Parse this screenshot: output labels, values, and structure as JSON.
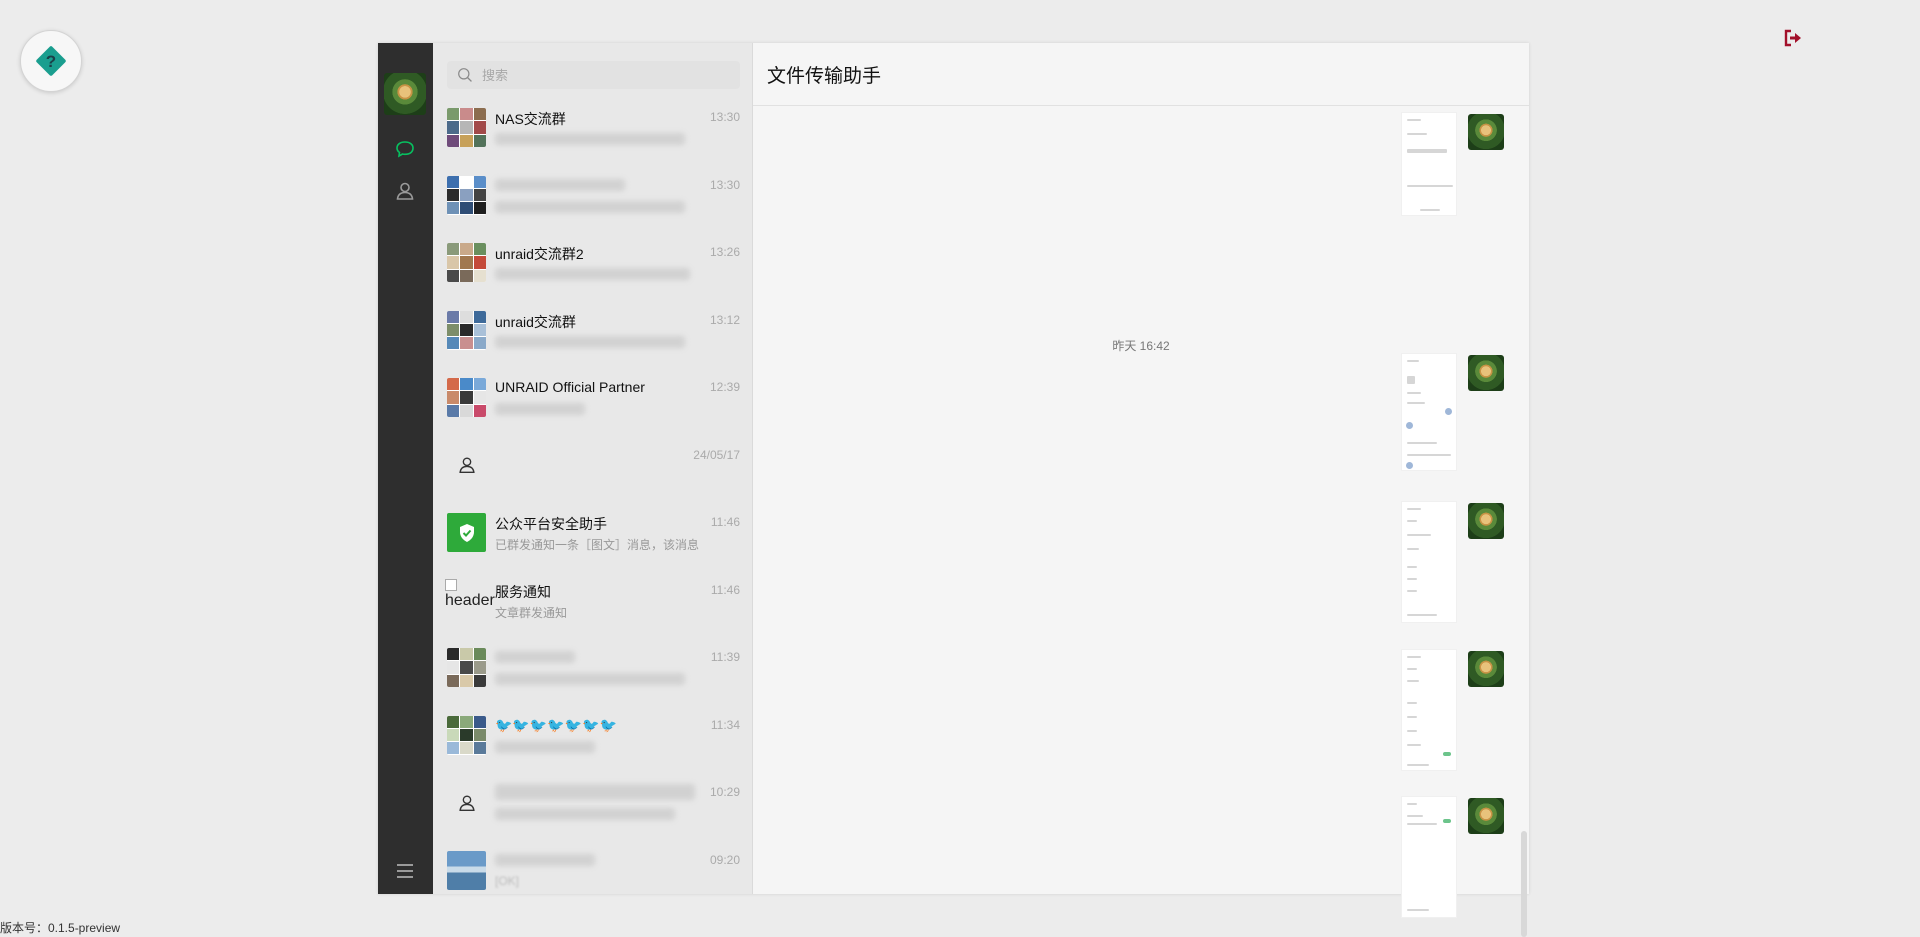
{
  "version_text": "版本号：0.1.5-preview",
  "search": {
    "placeholder": "搜索"
  },
  "chat": {
    "title": "文件传输助手",
    "timestamp": "昨天 16:42"
  },
  "conversations": [
    {
      "name": "NAS交流群",
      "time": "13:30",
      "preview": "",
      "avatar": "group"
    },
    {
      "name": "",
      "time": "13:30",
      "preview": "",
      "avatar": "group"
    },
    {
      "name": "unraid交流群2",
      "time": "13:26",
      "preview": "",
      "avatar": "group"
    },
    {
      "name": "unraid交流群",
      "time": "13:12",
      "preview": "",
      "avatar": "group"
    },
    {
      "name": "UNRAID Official Partner",
      "time": "12:39",
      "preview": "",
      "avatar": "group"
    },
    {
      "name": "",
      "time": "24/05/17",
      "preview": "",
      "avatar": "person-icon"
    },
    {
      "name": "公众平台安全助手",
      "time": "11:46",
      "preview": "已群发通知一条［图文］消息，该消息",
      "avatar": "shield-icon"
    },
    {
      "name": "服务通知",
      "time": "11:46",
      "preview": "文章群发通知",
      "avatar": "broken-image",
      "avatar_alt": "header"
    },
    {
      "name": "",
      "time": "11:39",
      "preview": "",
      "avatar": "group"
    },
    {
      "name": "🐦🐦🐦🐦🐦🐦🐦",
      "time": "11:34",
      "preview": "",
      "avatar": "group"
    },
    {
      "name": "",
      "time": "10:29",
      "preview": "",
      "avatar": "person-icon"
    },
    {
      "name": "",
      "time": "09:20",
      "preview": "[OK]",
      "avatar": "photo"
    }
  ],
  "colors": {
    "rail": "#2e2e2e",
    "accent": "#07c160",
    "logout": "#a2102a",
    "help": "#1a9e8f"
  }
}
